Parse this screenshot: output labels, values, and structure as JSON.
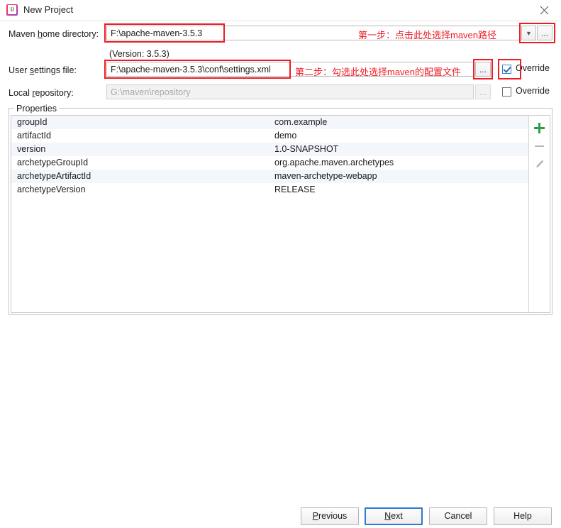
{
  "window": {
    "title": "New Project",
    "icon": "intellij-idea-icon",
    "close_icon": "close-icon"
  },
  "form": {
    "maven_home": {
      "label_before": "Maven ",
      "label_mnemonic": "h",
      "label_after": "ome directory:",
      "value": "F:\\apache-maven-3.5.3",
      "dropdown_icon": "chevron-down-icon",
      "browse_label": "...",
      "version_text": "(Version: 3.5.3)"
    },
    "user_settings": {
      "label_before": "User ",
      "label_mnemonic": "s",
      "label_after": "ettings file:",
      "value": "F:\\apache-maven-3.5.3\\conf\\settings.xml",
      "browse_label": "...",
      "override_label": "Override",
      "override_checked": true
    },
    "local_repository": {
      "label_before": "Local ",
      "label_mnemonic": "r",
      "label_after": "epository:",
      "value": "G:\\maven\\repository",
      "browse_label": "...",
      "override_label": "Override",
      "override_checked": false
    }
  },
  "annotations": [
    {
      "text": "第一步：点击此处选择maven路径",
      "color": "#ee1c25"
    },
    {
      "text": "第二步：勾选此处选择maven的配置文件",
      "color": "#ee1c25"
    }
  ],
  "properties": {
    "group_title": "Properties",
    "rows": [
      {
        "key": "groupId",
        "value": "com.example"
      },
      {
        "key": "artifactId",
        "value": "demo"
      },
      {
        "key": "version",
        "value": "1.0-SNAPSHOT"
      },
      {
        "key": "archetypeGroupId",
        "value": "org.apache.maven.archetypes"
      },
      {
        "key": "archetypeArtifactId",
        "value": "maven-archetype-webapp"
      },
      {
        "key": "archetypeVersion",
        "value": "RELEASE"
      }
    ],
    "tools": {
      "add_icon": "plus-icon",
      "remove_icon": "minus-icon",
      "edit_icon": "pencil-icon",
      "add_color": "#2e9e3f"
    }
  },
  "footer": {
    "previous": {
      "before": "",
      "mnemonic": "P",
      "after": "revious"
    },
    "next": {
      "before": "",
      "mnemonic": "N",
      "after": "ext"
    },
    "cancel": "Cancel",
    "help": "Help"
  }
}
